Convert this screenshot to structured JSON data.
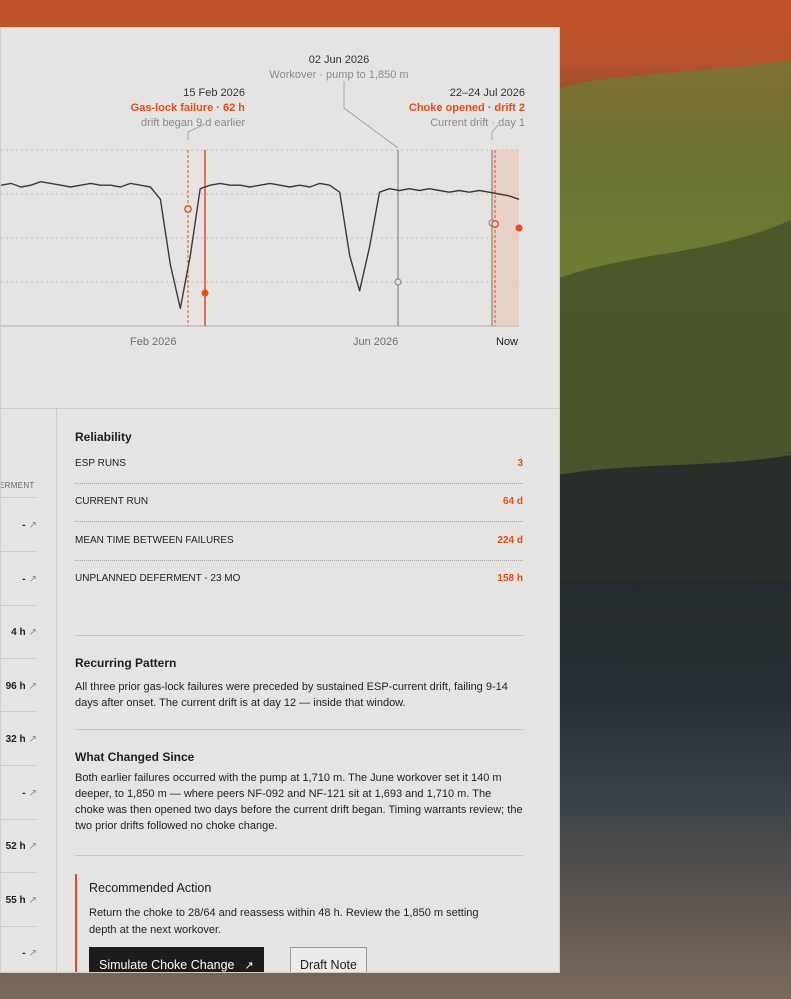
{
  "colors": {
    "accent": "#e64b1a",
    "panel": "#e6e4e3",
    "ink": "#1e1e1e",
    "muted": "#8a8a8a"
  },
  "chart": {
    "events": {
      "workover": {
        "date": "02 Jun 2026",
        "label": "Workover · pump to 1,850 m"
      },
      "gaslock": {
        "date": "15 Feb 2026",
        "label": "Gas-lock failure · 62 h",
        "note": "drift began 9 d earlier"
      },
      "choke": {
        "date": "22–24 Jul 2026",
        "label": "Choke opened · drift 2",
        "note": "Current drift · day 1"
      }
    },
    "x_ticks": [
      "Feb 2026",
      "Jun 2026",
      "Now"
    ]
  },
  "chart_data": {
    "type": "line",
    "x_ticks": [
      "Feb 2026",
      "Jun 2026",
      "Now"
    ],
    "series": [
      {
        "values": [
          0.8,
          0.81,
          0.79,
          0.8,
          0.82,
          0.81,
          0.8,
          0.79,
          0.8,
          0.81,
          0.8,
          0.8,
          0.79,
          0.81,
          0.8,
          0.79,
          0.72,
          0.35,
          0.1,
          0.4,
          0.78,
          0.8,
          0.81,
          0.8,
          0.8,
          0.79,
          0.8,
          0.81,
          0.8,
          0.79,
          0.8,
          0.79,
          0.81,
          0.8,
          0.76,
          0.4,
          0.2,
          0.45,
          0.76,
          0.78,
          0.77,
          0.78,
          0.77,
          0.78,
          0.77,
          0.76,
          0.77,
          0.76,
          0.77,
          0.76,
          0.75,
          0.74,
          0.72
        ]
      }
    ]
  },
  "left_table": {
    "header": "ERMENT",
    "rows": [
      {
        "value": "-",
        "arrow": "↗"
      },
      {
        "value": "-",
        "arrow": "↗"
      },
      {
        "value": "4 h",
        "arrow": "↗"
      },
      {
        "value": "96 h",
        "arrow": "↗"
      },
      {
        "value": "32 h",
        "arrow": "↗"
      },
      {
        "value": "-",
        "arrow": "↗"
      },
      {
        "value": "52 h",
        "arrow": "↗"
      },
      {
        "value": "55 h",
        "arrow": "↗"
      },
      {
        "value": "-",
        "arrow": "↗"
      }
    ]
  },
  "reliability": {
    "title": "Reliability",
    "metrics": [
      {
        "label": "ESP RUNS",
        "value": "3"
      },
      {
        "label": "CURRENT RUN",
        "value": "64 d"
      },
      {
        "label": "MEAN TIME BETWEEN FAILURES",
        "value": "224 d"
      },
      {
        "label": "UNPLANNED DEFERMENT - 23 MO",
        "value": "158 h"
      }
    ]
  },
  "pattern": {
    "title": "Recurring Pattern",
    "text": "All three prior gas-lock failures were preceded by sustained ESP-current drift, failing 9-14 days after onset. The current drift is at day 12 — inside that window."
  },
  "changed": {
    "title": "What Changed Since",
    "text": "Both earlier failures occurred with the pump at 1,710 m. The June workover set it 140 m deeper, to 1,850 m — where peers NF-092 and NF-121 sit at 1,693 and 1,710 m. The choke was then opened two days before the current drift began. Timing warrants review; the two prior drifts followed no choke change."
  },
  "action": {
    "title": "Recommended Action",
    "text": "Return the choke to 28/64 and reassess within 48 h. Review the 1,850 m setting depth at the next workover.",
    "primary_label": "Simulate Choke Change",
    "primary_arrow": "↗",
    "secondary_label": "Draft Note"
  }
}
